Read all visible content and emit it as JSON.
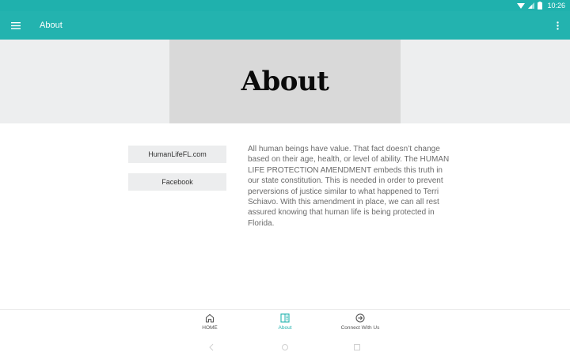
{
  "status_bar": {
    "time": "10:26",
    "icons": [
      "wifi-icon",
      "cell-signal-icon",
      "battery-icon"
    ]
  },
  "app_bar": {
    "title": "About",
    "menu_icon": "hamburger-menu-icon",
    "overflow_icon": "more-vert-icon"
  },
  "hero": {
    "title": "About"
  },
  "links": [
    {
      "label": "HumanLifeFL.com"
    },
    {
      "label": "Facebook"
    }
  ],
  "body": {
    "text": "All human beings have value. That fact doesn’t change based on their age, health, or level of ability. The HUMAN LIFE PROTECTION AMENDMENT embeds this truth in our state constitution. This is needed in order to prevent perversions of justice similar to what happened to Terri Schiavo. With this amendment in place, we can all rest assured knowing that human life is being protected in Florida."
  },
  "bottom_nav": {
    "items": [
      {
        "label": "HOME",
        "icon": "home-icon",
        "active": false
      },
      {
        "label": "About",
        "icon": "document-icon",
        "active": true
      },
      {
        "label": "Connect With Us",
        "icon": "arrow-circle-icon",
        "active": false
      }
    ]
  },
  "colors": {
    "primary": "#23b3af",
    "hero_bg": "#edeeef",
    "hero_box": "#d9d9d9",
    "button_bg": "#ecedee",
    "body_text": "#6b6b6b"
  }
}
